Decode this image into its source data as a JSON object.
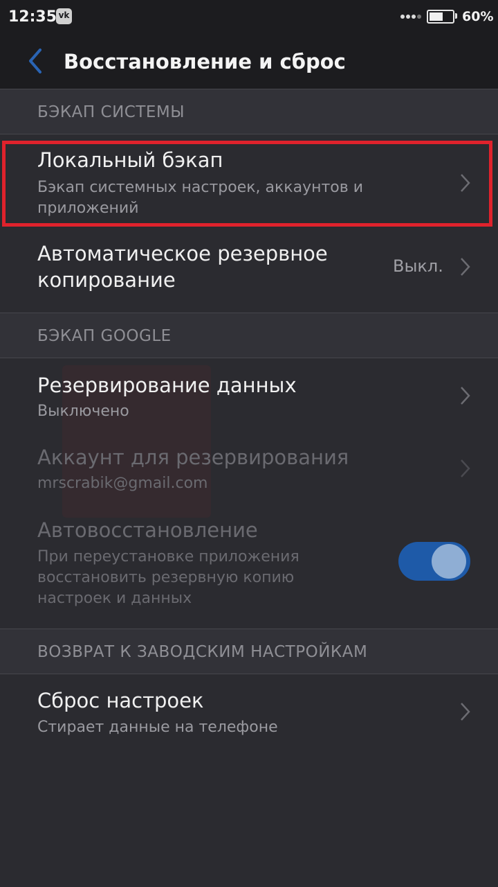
{
  "status_bar": {
    "time": "12:35",
    "notification_icon": "vk-icon",
    "vk_glyph": "vk",
    "battery_percent": "60%",
    "battery_level": 0.6
  },
  "app_bar": {
    "back_icon": "chevron-left-icon",
    "title": "Восстановление и сброс"
  },
  "sections": {
    "system_backup": {
      "header": "БЭКАП СИСТЕМЫ",
      "local_backup": {
        "title": "Локальный бэкап",
        "subtitle": "Бэкап системных настроек, аккаунтов и приложений"
      },
      "auto_backup": {
        "title": "Автоматическое резервное копирование",
        "value": "Выкл."
      }
    },
    "google_backup": {
      "header": "БЭКАП GOOGLE",
      "data_backup": {
        "title": "Резервирование данных",
        "subtitle": "Выключено"
      },
      "backup_account": {
        "title": "Аккаунт для резервирования",
        "subtitle": "mrscrabik@gmail.com"
      },
      "auto_restore": {
        "title": "Автовосстановление",
        "subtitle": "При переустановке приложения восстановить резервную копию настроек и данных",
        "toggle_on": true
      }
    },
    "factory_reset": {
      "header": "ВОЗВРАТ К ЗАВОДСКИМ НАСТРОЙКАМ",
      "reset": {
        "title": "Сброс настроек",
        "subtitle": "Стирает данные на телефоне"
      }
    }
  },
  "colors": {
    "background": "#2b2b30",
    "bar": "#1c1c1f",
    "accent": "#2a64b4",
    "highlight": "#e0222c"
  }
}
